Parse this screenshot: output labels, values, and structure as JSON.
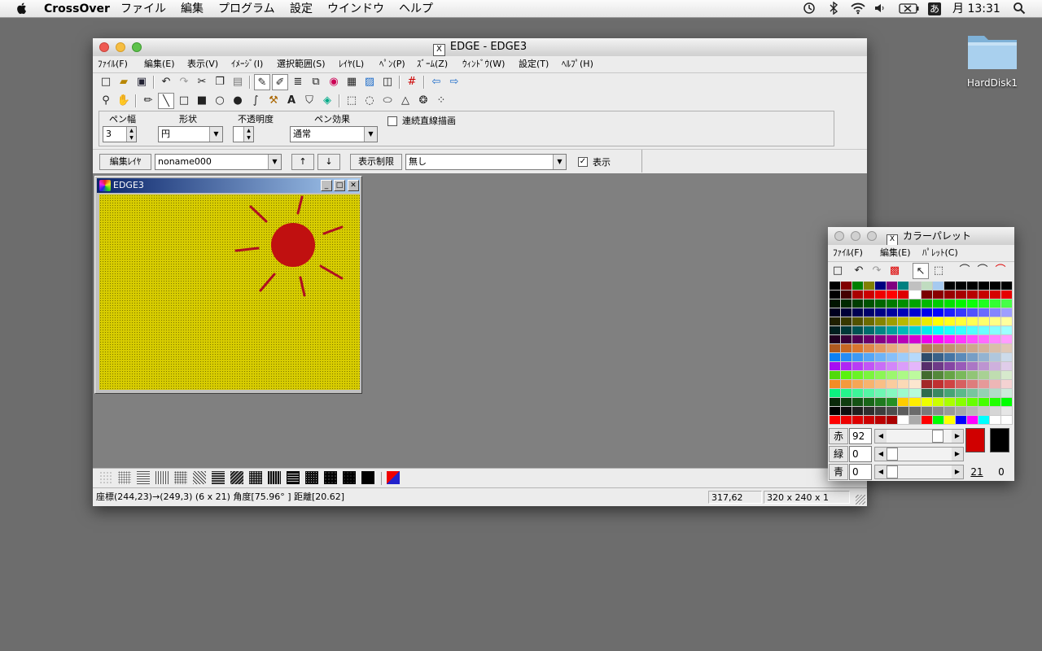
{
  "menubar": {
    "app": "CrossOver",
    "items": [
      "ファイル",
      "編集",
      "プログラム",
      "設定",
      "ウインドウ",
      "ヘルプ"
    ],
    "input_mode": "あ",
    "clock": "月 13:31"
  },
  "desktop": {
    "icon_label": "HardDisk1"
  },
  "main_window": {
    "title": "EDGE - EDGE3",
    "menus": [
      "ﾌｧｲﾙ(F)",
      "編集(E)",
      "表示(V)",
      "ｲﾒｰｼﾞ(I)",
      "選択範囲(S)",
      "ﾚｲﾔ(L)",
      "ﾍﾟﾝ(P)",
      "ｽﾞｰﾑ(Z)",
      "ｳｨﾝﾄﾞｳ(W)",
      "設定(T)",
      "ﾍﾙﾌﾟ(H)"
    ],
    "pen": {
      "width_label": "ペン幅",
      "width_value": "3",
      "shape_label": "形状",
      "shape_value": "円",
      "opacity_label": "不透明度",
      "effect_label": "ペン効果",
      "effect_value": "通常",
      "continuous_label": "連続直線描画"
    },
    "layer": {
      "edit_label": "編集ﾚｲﾔ",
      "name": "noname000",
      "up": "↑",
      "down": "↓",
      "limit_label": "表示制限",
      "limit_value": "無し",
      "show_label": "表示"
    },
    "child": {
      "title": "EDGE3"
    },
    "status": {
      "coords": "座標(244,23)→(249,3)  (6 x 21)  角度[75.96° ]  距離[20.62]",
      "cursor": "317,62",
      "size": "320 x 240 x 1"
    }
  },
  "palette_window": {
    "title": "カラーパレット",
    "menus": [
      "ﾌｧｲﾙ(F)",
      "編集(E)",
      "ﾊﾟﾚｯﾄ(C)"
    ],
    "channels": [
      {
        "label": "赤",
        "value": "92"
      },
      {
        "label": "緑",
        "value": "0"
      },
      {
        "label": "青",
        "value": "0"
      }
    ],
    "fg_index": "21",
    "bg_index": "0",
    "fg_color": "#d00000",
    "bg_color": "#000000"
  },
  "colors": {
    "canvas": "#d7cc00",
    "sun": "#c01010",
    "title_gradient_start": "#0a246a"
  }
}
